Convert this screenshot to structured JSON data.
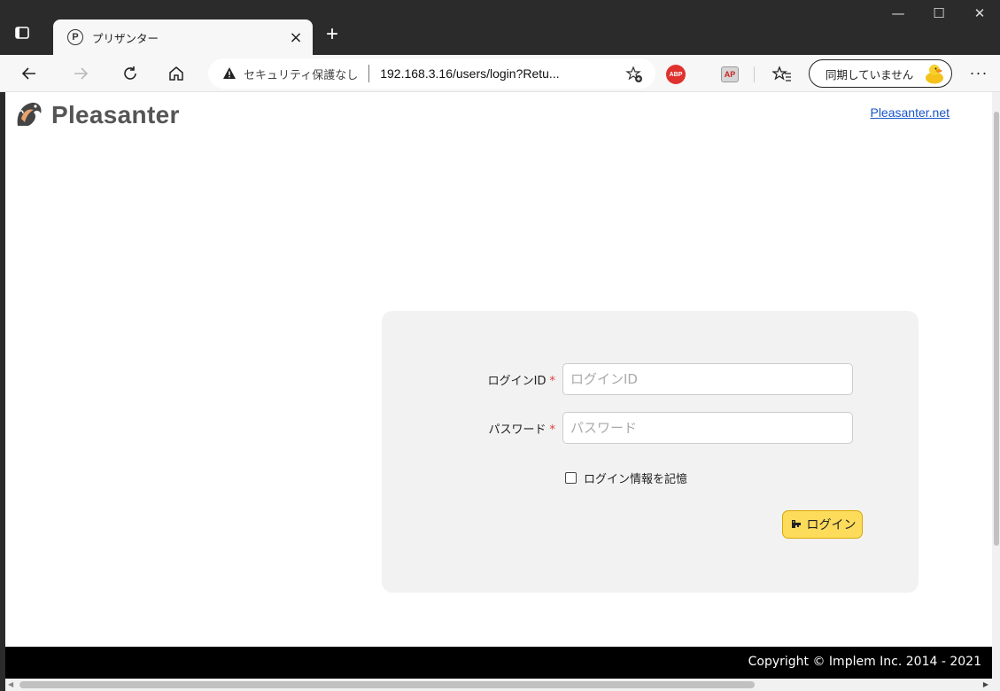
{
  "browser": {
    "tab": {
      "favicon": "P",
      "title": "プリザンター"
    },
    "new_tab_label": "+",
    "window_controls": {
      "minimize": "—",
      "maximize": "☐",
      "close": "✕"
    },
    "address": {
      "security_label": "セキュリティ保護なし",
      "url": "192.168.3.16/users/login?Retu..."
    },
    "extensions": {
      "abp": "ABP",
      "ap": "AP"
    },
    "sync_label": "同期していません",
    "more_label": "···"
  },
  "page": {
    "logo_text": "Pleasanter",
    "site_link": "Pleasanter.net",
    "login": {
      "login_id": {
        "label": "ログインID",
        "required_mark": "*",
        "placeholder": "ログインID",
        "value": ""
      },
      "password": {
        "label": "パスワード",
        "required_mark": "*",
        "placeholder": "パスワード",
        "value": ""
      },
      "remember_label": "ログイン情報を記憶",
      "remember_checked": false,
      "submit_label": "ログイン"
    },
    "footer": "Copyright © Implem Inc. 2014 - 2021"
  },
  "colors": {
    "chrome_dark": "#2b2b2b",
    "toolbar": "#f7f7f7",
    "panel": "#f2f2f2",
    "button_yellow": "#fddc5c",
    "required_red": "#e23a3a",
    "link_blue": "#1a55c9",
    "footer_bg": "#000000"
  },
  "icons": [
    "tab-actions-icon",
    "close-icon",
    "back-arrow-icon",
    "forward-arrow-icon",
    "refresh-icon",
    "home-icon",
    "warning-icon",
    "add-favorite-icon",
    "favorites-icon",
    "duck-avatar-icon",
    "key-icon",
    "pleasanter-logo-icon"
  ]
}
